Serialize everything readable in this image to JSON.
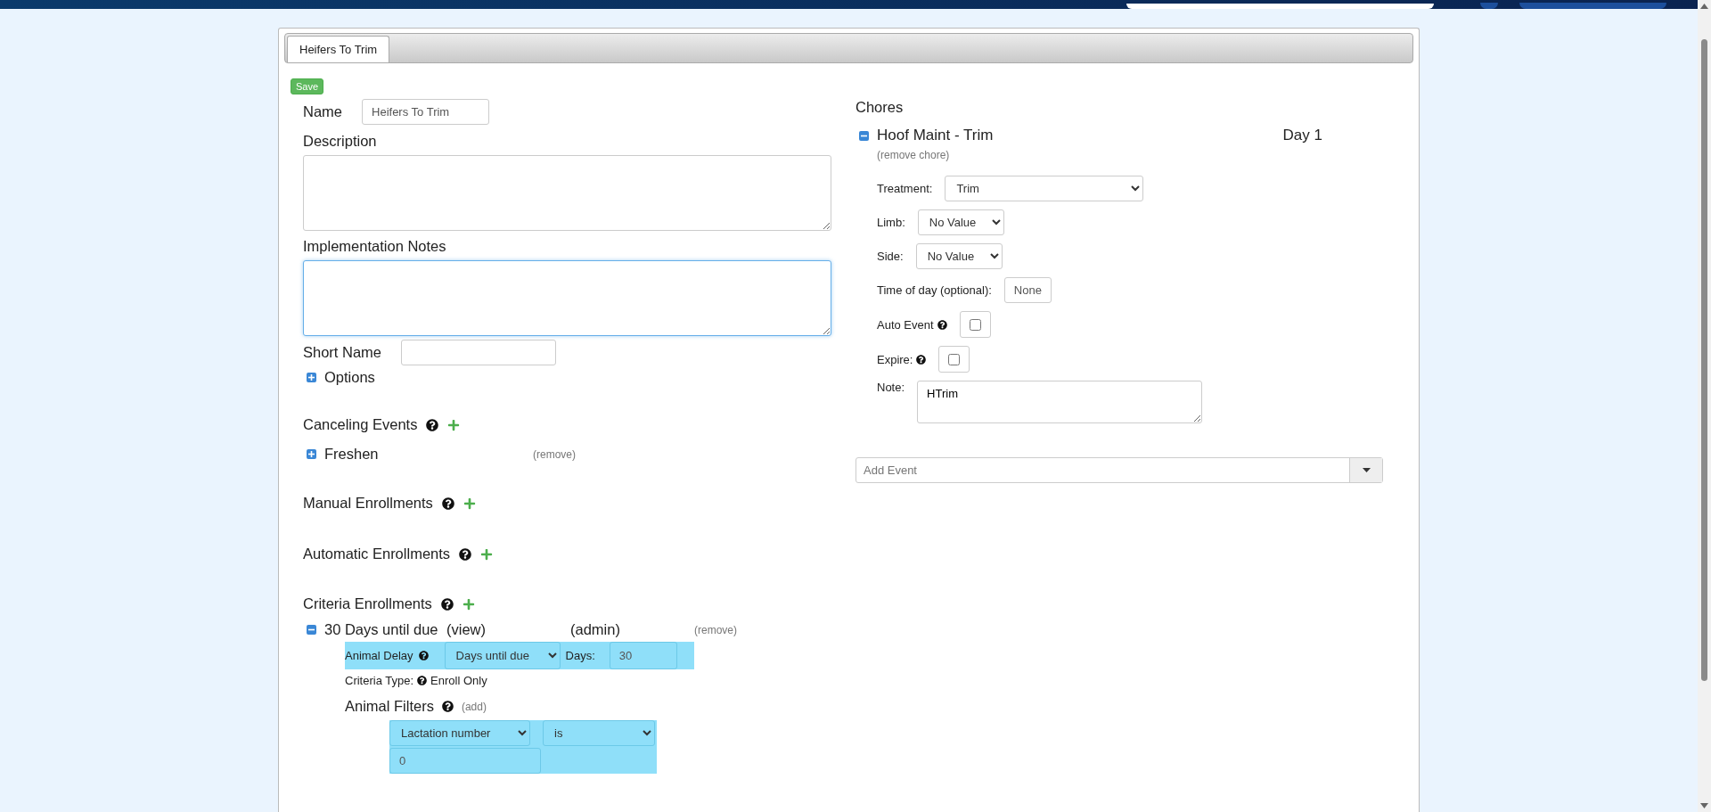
{
  "tab": {
    "label": "Heifers To Trim",
    "selected": true
  },
  "save_button": "Save",
  "form": {
    "name": {
      "label": "Name",
      "value": "Heifers To Trim"
    },
    "description": {
      "label": "Description"
    },
    "implementation_notes": {
      "label": "Implementation Notes",
      "focused": true
    },
    "short_name": {
      "label": "Short Name"
    },
    "options": {
      "label": "Options",
      "expanded": false
    }
  },
  "canceling_events": {
    "title": "Canceling Events",
    "items": [
      {
        "label": "Freshen",
        "expanded": false,
        "remove": "(remove)"
      }
    ]
  },
  "manual_enrollments": {
    "title": "Manual Enrollments"
  },
  "automatic_enrollments": {
    "title": "Automatic Enrollments"
  },
  "criteria_enrollments": {
    "title": "Criteria Enrollments",
    "items": [
      {
        "name": "30 Days until due",
        "view": "(view)",
        "admin": "(admin)",
        "remove": "(remove)",
        "expanded": true,
        "delay_label": "Animal Delay",
        "delay_select": "Days until due",
        "days_label": "Days:",
        "days_value": "30",
        "criteria_type_label": "Criteria Type:",
        "criteria_type": "Enroll Only",
        "filters_title": "Animal Filters",
        "filters_add": "(add)",
        "filters": [
          {
            "field": "Lactation number",
            "operator": "is",
            "value": "0"
          }
        ]
      }
    ]
  },
  "chores": {
    "title": "Chores",
    "items": [
      {
        "name": "Hoof Maint - Trim",
        "day": "Day 1",
        "expanded": true,
        "remove": "(remove chore)",
        "fields": [
          {
            "kind": "select",
            "label": "Treatment:",
            "value": "Trim",
            "wide": true
          },
          {
            "kind": "select",
            "label": "Limb:",
            "value": "No Value",
            "wide": false
          },
          {
            "kind": "select",
            "label": "Side:",
            "value": "No Value",
            "wide": false
          },
          {
            "kind": "button",
            "label": "Time of day (optional):",
            "value": "None"
          },
          {
            "kind": "checkbox",
            "label": "Auto Event",
            "checked": false
          },
          {
            "kind": "checkbox",
            "label": "Expire:",
            "checked": false
          },
          {
            "kind": "textarea",
            "label": "Note:",
            "value": "HTrim"
          }
        ]
      }
    ],
    "add_event": {
      "placeholder": "Add Event"
    }
  }
}
